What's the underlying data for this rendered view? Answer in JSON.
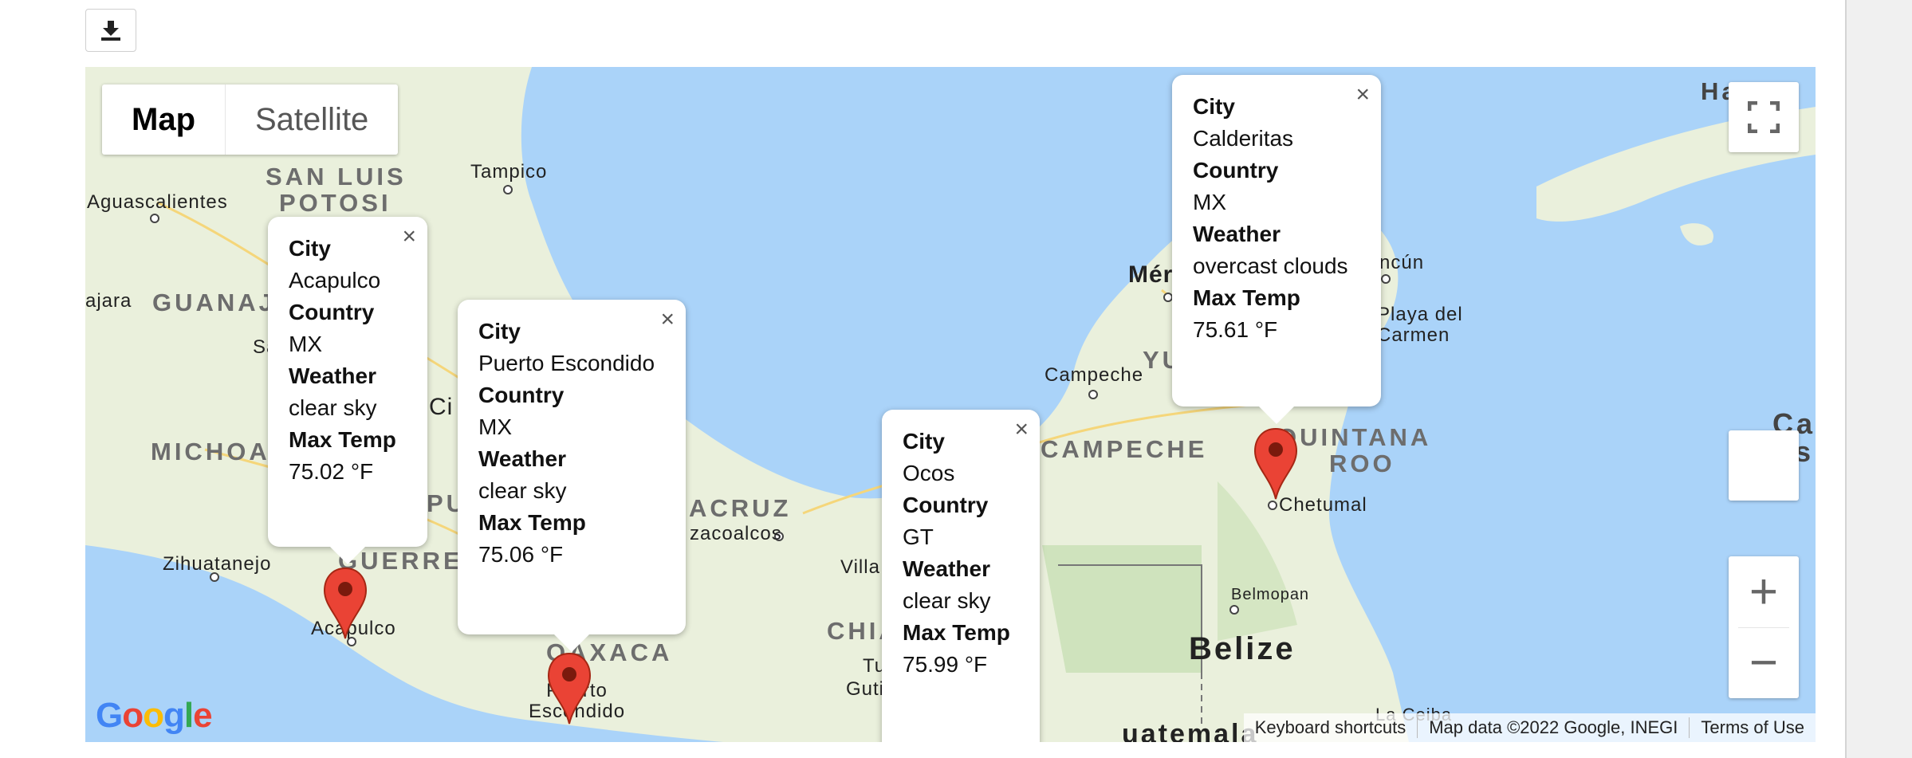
{
  "toolbar": {
    "download_icon": "download-icon"
  },
  "map": {
    "type_buttons": {
      "map": "Map",
      "satellite": "Satellite"
    },
    "labels": {
      "tampico": "Tampico",
      "san_luis": "SAN LUIS",
      "potosi": "POTOSI",
      "aguascalientes": "Aguascalientes",
      "jara": "ajara",
      "guanaju": "GUANAJU",
      "michoac": "MICHOAC",
      "zihuatanejo": "Zihuatanejo",
      "guerrero": "GUERRERO",
      "acapulco": "Acapulco",
      "oaxaca": "OAXACA",
      "puerto_escondido": "Puerto\nEscondido",
      "veracruz": "ACRUZ",
      "coatzacoalcos": "zacoalcos",
      "villa": "Villa",
      "chia": "CHIA",
      "tuxtla": "Tu",
      "guti": "Guti",
      "campeche_city": "Campeche",
      "campeche_state": "CAMPECHE",
      "merida": "Mér",
      "yucatan": "YU",
      "cancun": "ncún",
      "playa_del_carmen": "Playa del\nCarmen",
      "quintana": "QUINTANA",
      "roo": "ROO",
      "chetumal": "Chetumal",
      "belmopan": "Belmopan",
      "belize": "Belize",
      "guatemala": "uatemala",
      "la_ceiba": "La Ceiba",
      "havana": "Ha",
      "cay": "Ca",
      "cay2": "Is",
      "ci": "Ci",
      "pu": "PU",
      "sa": "Sa"
    },
    "attribution": {
      "keyboard": "Keyboard shortcuts",
      "data": "Map data ©2022 Google, INEGI",
      "terms": "Terms of Use"
    },
    "logo": "Google",
    "zoom": {
      "in": "+",
      "out": "−"
    }
  },
  "infowindows": [
    {
      "city_label": "City",
      "city": "Acapulco",
      "country_label": "Country",
      "country": "MX",
      "weather_label": "Weather",
      "weather": "clear sky",
      "temp_label": "Max Temp",
      "temp": "75.02 °F",
      "close": "×"
    },
    {
      "city_label": "City",
      "city": "Puerto Escondido",
      "country_label": "Country",
      "country": "MX",
      "weather_label": "Weather",
      "weather": "clear sky",
      "temp_label": "Max Temp",
      "temp": "75.06 °F",
      "close": "×"
    },
    {
      "city_label": "City",
      "city": "Ocos",
      "country_label": "Country",
      "country": "GT",
      "weather_label": "Weather",
      "weather": "clear sky",
      "temp_label": "Max Temp",
      "temp": "75.99 °F",
      "close": "×"
    },
    {
      "city_label": "City",
      "city": "Calderitas",
      "country_label": "Country",
      "country": "MX",
      "weather_label": "Weather",
      "weather": "overcast clouds",
      "temp_label": "Max Temp",
      "temp": "75.61 °F",
      "close": "×"
    }
  ],
  "colors": {
    "water": "#aad3f9",
    "land": "#eaf0dc",
    "marker": "#ea4335",
    "marker_dark": "#a52714"
  }
}
